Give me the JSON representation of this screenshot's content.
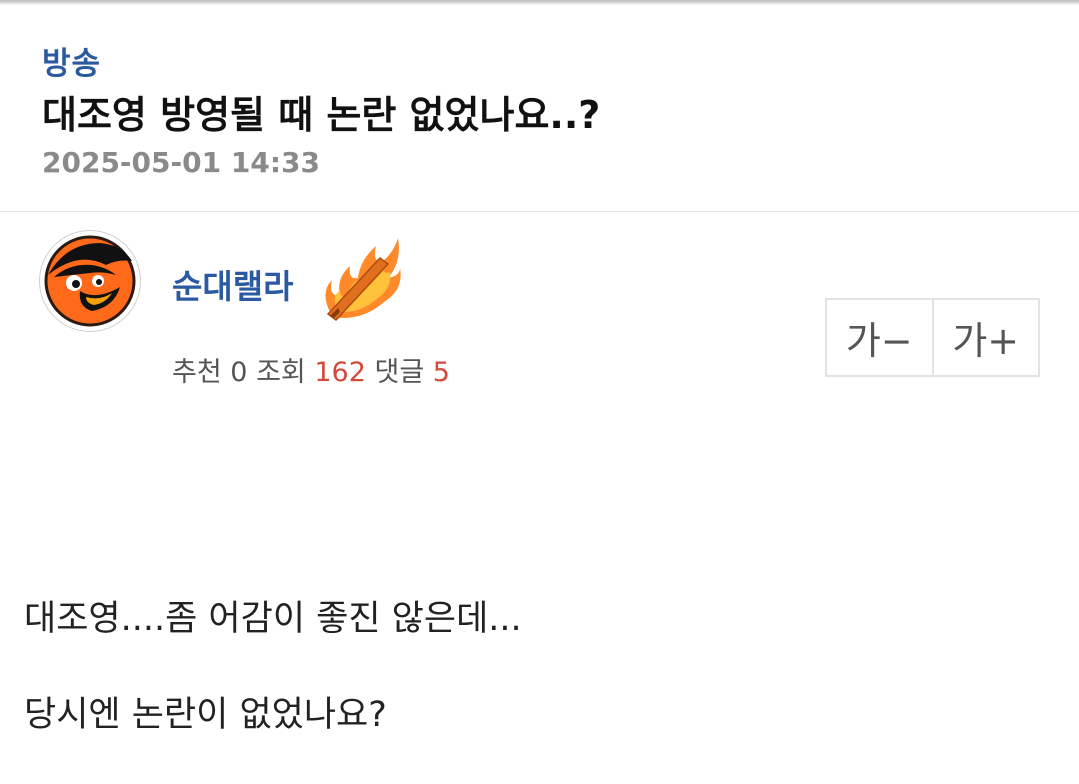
{
  "post": {
    "category": "방송",
    "title": "대조영 방영될 때 논란 없었나요..?",
    "datetime": "2025-05-01 14:33"
  },
  "author": {
    "name": "순대랠라",
    "avatar_icon": "orioles-bird-logo-icon",
    "badge_icon": "flaming-bat-icon"
  },
  "stats": {
    "recommend_label": "추천",
    "recommend_count": "0",
    "views_label": "조회",
    "views_count": "162",
    "comments_label": "댓글",
    "comments_count": "5"
  },
  "font_size": {
    "decrease_label": "가−",
    "increase_label": "가+"
  },
  "content": {
    "lines": [
      "대조영....좀 어감이 좋진 않은데...",
      "당시엔 논란이 없었나요?"
    ]
  },
  "colors": {
    "accent_blue": "#2c5aa0",
    "count_red": "#d24a3c",
    "meta_gray": "#8a8a8a"
  }
}
